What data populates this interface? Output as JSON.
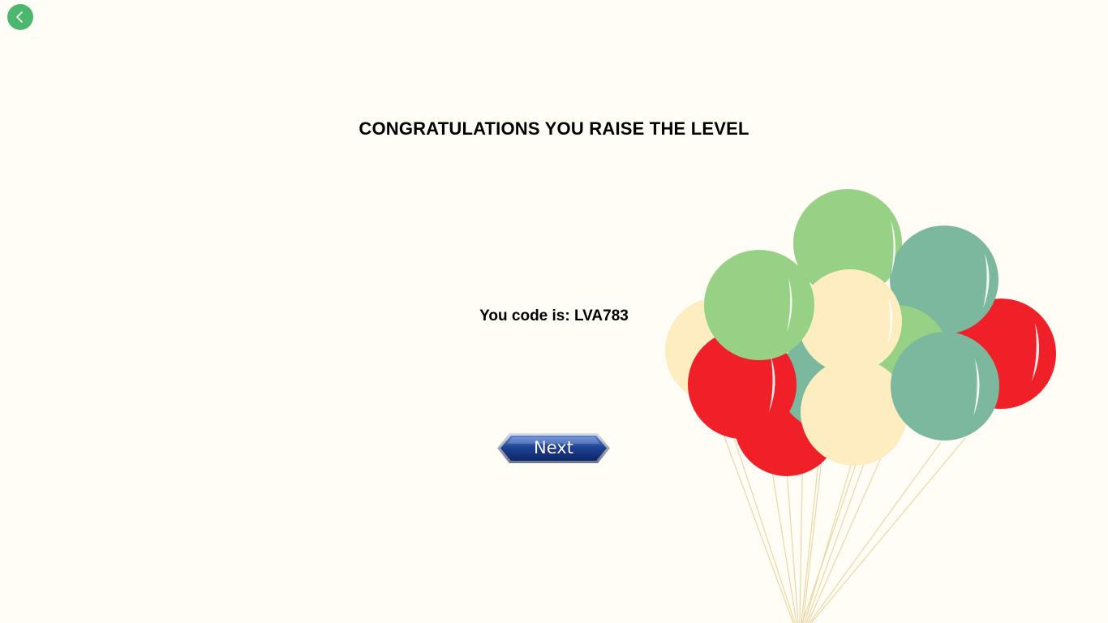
{
  "header": {
    "back_icon": "chevron-left-icon"
  },
  "main": {
    "title": "CONGRATULATIONS YOU RAISE THE LEVEL",
    "code_label": "You code is: LVA783",
    "next_label": "Next"
  },
  "colors": {
    "background": "#fffdf6",
    "back_button": "#4cb86e",
    "next_button": "#1e3f8f",
    "balloon_green": "#96d185",
    "balloon_teal": "#7bb89d",
    "balloon_cream": "#fdedc0",
    "balloon_red": "#ef2027",
    "string": "#e9d7a7"
  },
  "decoration": {
    "balloons_icon": "balloons-illustration"
  }
}
